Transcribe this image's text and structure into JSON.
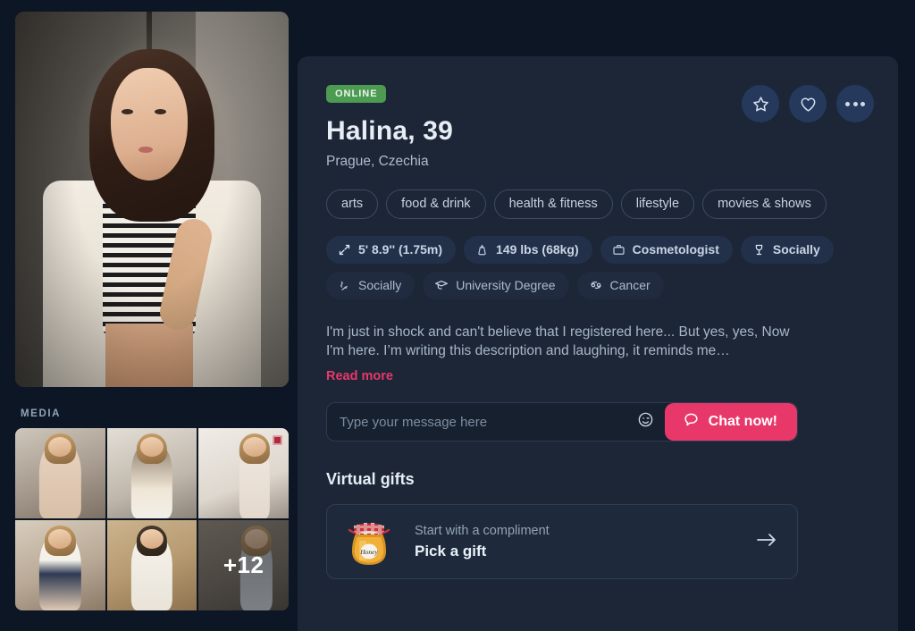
{
  "theme": {
    "background": "#0d1624",
    "panel": "#1c2636",
    "accent_pink": "#e8386a",
    "online_green": "#4d9a52",
    "chip_bg": "#22304a",
    "action_circle": "#24395c"
  },
  "profile": {
    "status_badge": "ONLINE",
    "name_age": "Halina, 39",
    "location": "Prague, Czechia",
    "bio": "I'm just in shock and can't believe that I registered here... But yes, yes, Now I'm here. I’m writing this description and laughing, it reminds me…",
    "read_more_label": "Read more"
  },
  "actions": [
    {
      "name": "favorite-button",
      "icon": "star-icon"
    },
    {
      "name": "like-button",
      "icon": "heart-icon"
    },
    {
      "name": "more-options-button",
      "icon": "more-dots-icon"
    }
  ],
  "interests": [
    "arts",
    "food & drink",
    "health & fitness",
    "lifestyle",
    "movies & shows"
  ],
  "attributes": [
    {
      "icon": "height-icon",
      "label": "5' 8.9'' (1.75m)",
      "style": "solid"
    },
    {
      "icon": "weight-icon",
      "label": "149 lbs (68kg)",
      "style": "solid"
    },
    {
      "icon": "briefcase-icon",
      "label": "Cosmetologist",
      "style": "solid"
    },
    {
      "icon": "wine-glass-icon",
      "label": "Socially",
      "style": "solid"
    },
    {
      "icon": "cigarette-icon",
      "label": "Socially",
      "style": "dim"
    },
    {
      "icon": "graduation-cap-icon",
      "label": "University Degree",
      "style": "dim"
    },
    {
      "icon": "zodiac-cancer-icon",
      "label": "Cancer",
      "style": "dim"
    }
  ],
  "message": {
    "placeholder": "Type your message here",
    "value": "",
    "emoji_icon": "wink-smiley-icon",
    "chat_button_label": "Chat now!",
    "chat_button_icon": "chat-bubble-icon"
  },
  "gifts": {
    "section_title": "Virtual gifts",
    "card_subtitle": "Start with a compliment",
    "card_title": "Pick a gift",
    "card_icon": "honey-jar-icon",
    "arrow_icon": "arrow-right-icon"
  },
  "media": {
    "label": "MEDIA",
    "more_count": "+12",
    "thumbnails": [
      {
        "name": "media-thumb-1",
        "badge": false
      },
      {
        "name": "media-thumb-2",
        "badge": false
      },
      {
        "name": "media-thumb-3",
        "badge": true
      },
      {
        "name": "media-thumb-4",
        "badge": false
      },
      {
        "name": "media-thumb-5",
        "badge": false
      },
      {
        "name": "media-thumb-6",
        "badge": false
      }
    ]
  }
}
